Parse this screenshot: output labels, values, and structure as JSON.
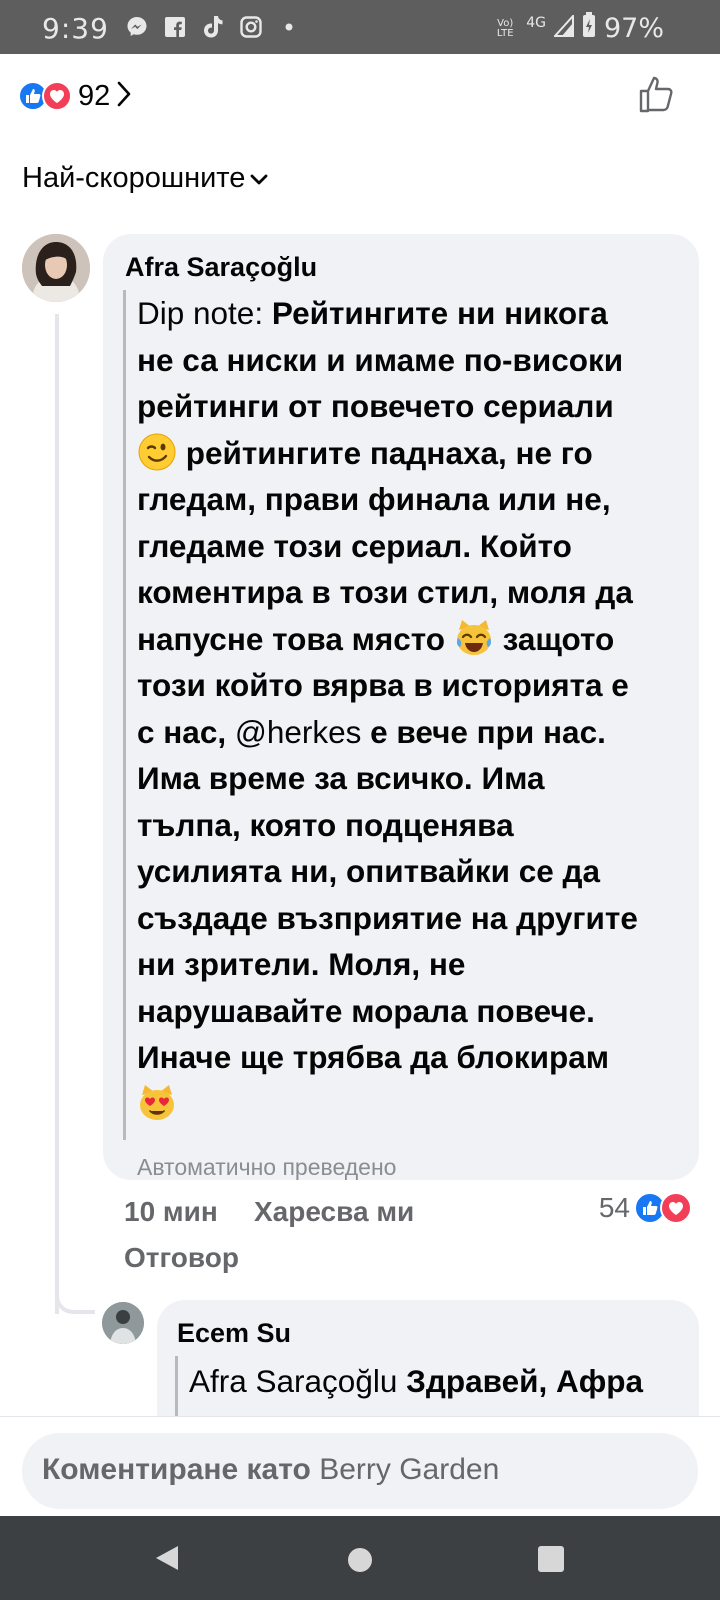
{
  "status_bar": {
    "time": "9:39",
    "icons": [
      "messenger-icon",
      "facebook-icon",
      "tiktok-icon",
      "instagram-icon",
      "dot-icon"
    ],
    "network_label": "Vo) LTE",
    "network_type": "4G",
    "battery": "97%"
  },
  "reactions": {
    "count": "92",
    "types": [
      "like",
      "love"
    ],
    "colors": {
      "like": "#1877f2",
      "love": "#f33e58"
    }
  },
  "sort": {
    "label": "Най-скорошните"
  },
  "comment": {
    "author": "Afra Saraçoğlu",
    "line1_prefix": "Dip note: ",
    "line1_bold": "Рейтингите ни никога",
    "line2": "не са ниски и имаме по-високи",
    "line3": "рейтинги от повечето сериали",
    "line4": " рейтингите паднаха, не го",
    "line5": "гледам, прави финала или не,",
    "line6": "гледаме този сериал. Който",
    "line7": "коментира в този стил, моля да",
    "line8": "напусне това място",
    "line8b": " защото",
    "line9": "този който вярва в историята е",
    "line10_a": "с нас, ",
    "line10_mention": "@herkes",
    "line10_b": " е вече при нас.",
    "line11": "Има време за всичко. Има",
    "line12": "тълпа, която подценява",
    "line13": "усилията ни, опитвайки се да",
    "line14": "създаде възприятие на другите",
    "line15": "ни зрители. Моля, не",
    "line16": "нарушавайте морала повече.",
    "line17": "Иначе ще трябва да блокирам",
    "emojis": [
      "winking-face-emoji",
      "crying-laughing-cat-emoji",
      "heart-eyes-cat-emoji"
    ],
    "auto_translated": "Автоматично преведено",
    "time": "10 мин",
    "like_label": "Харесва ми",
    "reply_label": "Отговор",
    "reaction_count": "54"
  },
  "reply": {
    "author": "Ecem Su",
    "mention": "Afra Saraçoğlu",
    "text": " Здравей, Афра"
  },
  "composer": {
    "prefix": "Коментиране като ",
    "name": "Berry Garden"
  }
}
